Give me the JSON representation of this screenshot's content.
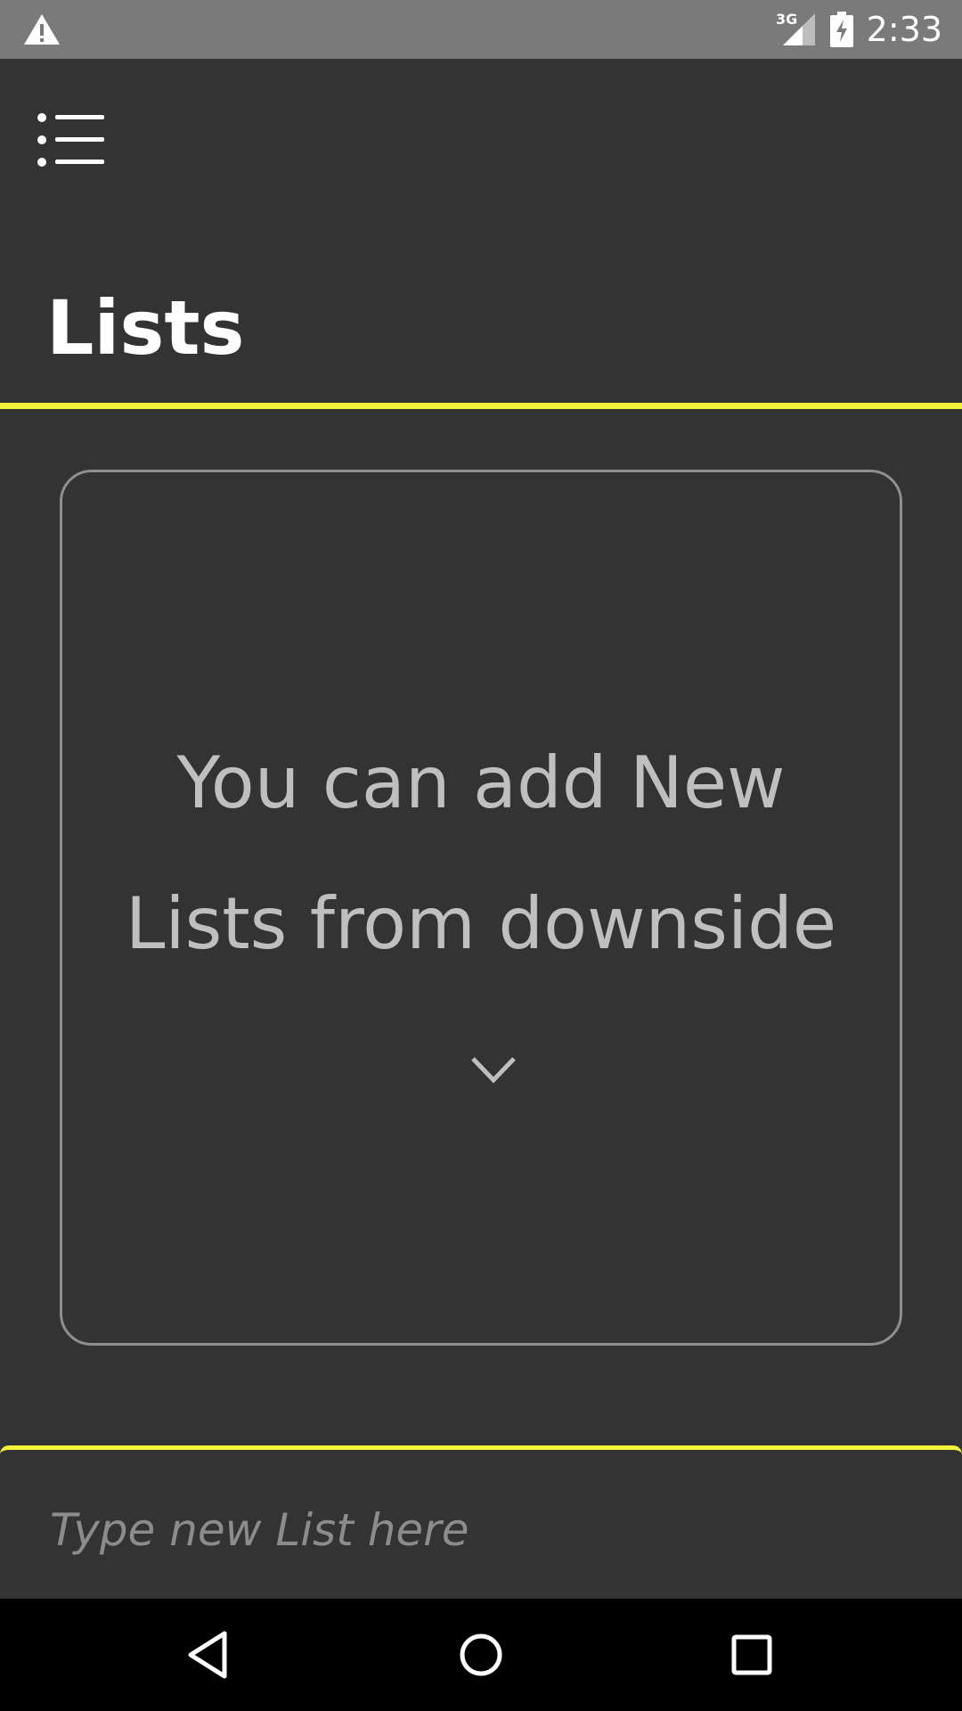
{
  "status_bar": {
    "time": "2:33",
    "network": "3G",
    "icons": [
      "warning-icon",
      "signal-icon",
      "battery-charging-icon"
    ]
  },
  "header": {
    "menu_icon": "menu-list-icon",
    "title": "Lists"
  },
  "empty_state": {
    "message": "You can add New Lists from downside",
    "icon": "chevron-down-icon"
  },
  "input": {
    "placeholder": "Type new List here",
    "value": ""
  },
  "nav_bar": {
    "icons": [
      "back-icon",
      "home-icon",
      "recents-icon"
    ]
  },
  "colors": {
    "background": "#333333",
    "accent": "#f2f23a",
    "status_bar": "#7a7a7a",
    "card_border": "#8f8f8f",
    "muted_text": "#bfbfbf"
  }
}
